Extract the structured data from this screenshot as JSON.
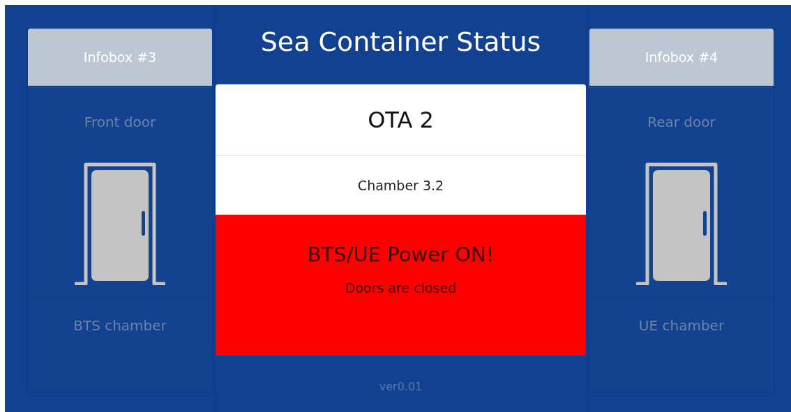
{
  "title": "Sea Container Status",
  "infoboxes": [
    {
      "header": "Infobox #3",
      "door": {
        "label": "Front door",
        "open": false
      },
      "chamber": "BTS chamber"
    },
    {
      "header": "Infobox #4",
      "door": {
        "label": "Rear door",
        "open": false
      },
      "chamber": "UE chamber"
    }
  ],
  "site": {
    "name": "OTA 2",
    "chamber": "Chamber 3.2"
  },
  "status": {
    "kind": "alarm",
    "message": "BTS/UE Power ON!",
    "detail": "Doors are closed"
  },
  "version": "ver0.01"
}
